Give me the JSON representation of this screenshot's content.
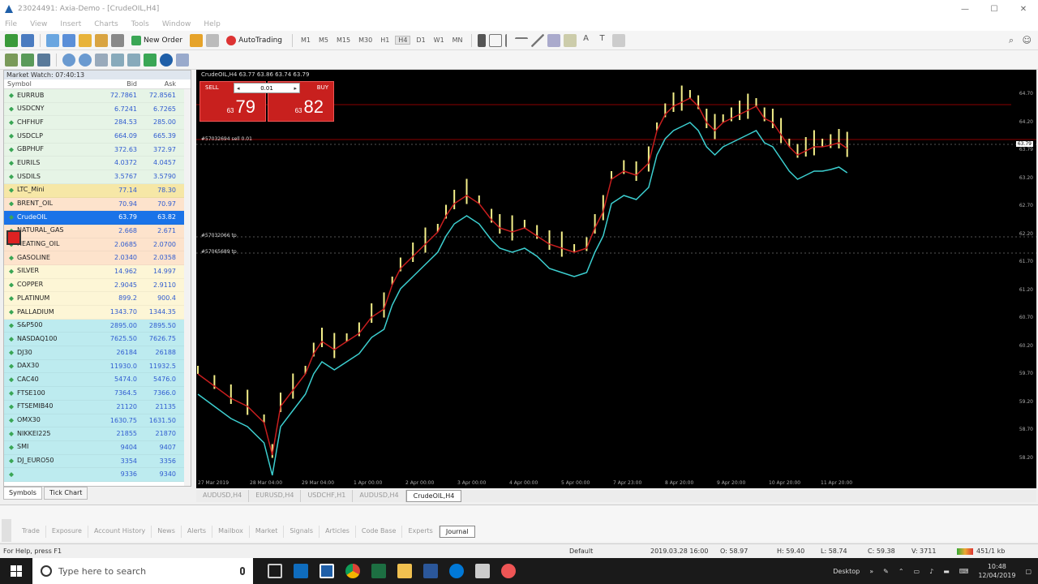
{
  "window": {
    "title": "23024491: Axia-Demo - [CrudeOIL,H4]"
  },
  "menu": [
    "File",
    "View",
    "Insert",
    "Charts",
    "Tools",
    "Window",
    "Help"
  ],
  "toolbar": {
    "new_order": "New Order",
    "autotrading": "AutoTrading",
    "timeframes": [
      "M1",
      "M5",
      "M15",
      "M30",
      "H1",
      "H4",
      "D1",
      "W1",
      "MN"
    ],
    "active_timeframe": "H4"
  },
  "market_watch": {
    "title": "Market Watch: 07:40:13",
    "columns": [
      "Symbol",
      "Bid",
      "Ask"
    ],
    "rows": [
      {
        "symbol": "EURRUB",
        "bid": "72.7861",
        "ask": "72.8561",
        "bg": "#e6f4e6"
      },
      {
        "symbol": "USDCNY",
        "bid": "6.7241",
        "ask": "6.7265",
        "bg": "#e6f4e6"
      },
      {
        "symbol": "CHFHUF",
        "bid": "284.53",
        "ask": "285.00",
        "bg": "#e6f4e6"
      },
      {
        "symbol": "USDCLP",
        "bid": "664.09",
        "ask": "665.39",
        "bg": "#e6f4e6"
      },
      {
        "symbol": "GBPHUF",
        "bid": "372.63",
        "ask": "372.97",
        "bg": "#e6f4e6"
      },
      {
        "symbol": "EURILS",
        "bid": "4.0372",
        "ask": "4.0457",
        "bg": "#e6f4e6"
      },
      {
        "symbol": "USDILS",
        "bid": "3.5767",
        "ask": "3.5790",
        "bg": "#e6f4e6"
      },
      {
        "symbol": "LTC_Mini",
        "bid": "77.14",
        "ask": "78.30",
        "bg": "#f6e7a6"
      },
      {
        "symbol": "BRENT_OIL",
        "bid": "70.94",
        "ask": "70.97",
        "bg": "#fde3cc"
      },
      {
        "symbol": "CrudeOIL",
        "bid": "63.79",
        "ask": "63.82",
        "bg": "#1a73e8",
        "selected": true
      },
      {
        "symbol": "NATURAL_GAS",
        "bid": "2.668",
        "ask": "2.671",
        "bg": "#fde3cc"
      },
      {
        "symbol": "HEATING_OIL",
        "bid": "2.0685",
        "ask": "2.0700",
        "bg": "#fde3cc"
      },
      {
        "symbol": "GASOLINE",
        "bid": "2.0340",
        "ask": "2.0358",
        "bg": "#fde3cc"
      },
      {
        "symbol": "SILVER",
        "bid": "14.962",
        "ask": "14.997",
        "bg": "#fdf6d6"
      },
      {
        "symbol": "COPPER",
        "bid": "2.9045",
        "ask": "2.9110",
        "bg": "#fdf6d6"
      },
      {
        "symbol": "PLATINUM",
        "bid": "899.2",
        "ask": "900.4",
        "bg": "#fdf6d6"
      },
      {
        "symbol": "PALLADIUM",
        "bid": "1343.70",
        "ask": "1344.35",
        "bg": "#fdf6d6"
      },
      {
        "symbol": "S&P500",
        "bid": "2895.00",
        "ask": "2895.50",
        "bg": "#bdebef"
      },
      {
        "symbol": "NASDAQ100",
        "bid": "7625.50",
        "ask": "7626.75",
        "bg": "#bdebef"
      },
      {
        "symbol": "DJ30",
        "bid": "26184",
        "ask": "26188",
        "bg": "#bdebef"
      },
      {
        "symbol": "DAX30",
        "bid": "11930.0",
        "ask": "11932.5",
        "bg": "#bdebef"
      },
      {
        "symbol": "CAC40",
        "bid": "5474.0",
        "ask": "5476.0",
        "bg": "#bdebef"
      },
      {
        "symbol": "FTSE100",
        "bid": "7364.5",
        "ask": "7366.0",
        "bg": "#bdebef"
      },
      {
        "symbol": "FTSEMIB40",
        "bid": "21120",
        "ask": "21135",
        "bg": "#bdebef"
      },
      {
        "symbol": "OMX30",
        "bid": "1630.75",
        "ask": "1631.50",
        "bg": "#bdebef"
      },
      {
        "symbol": "NIKKEI225",
        "bid": "21855",
        "ask": "21870",
        "bg": "#bdebef"
      },
      {
        "symbol": "SMI",
        "bid": "9404",
        "ask": "9407",
        "bg": "#bdebef"
      },
      {
        "symbol": "DJ_EURO50",
        "bid": "3354",
        "ask": "3356",
        "bg": "#bdebef"
      },
      {
        "symbol": "",
        "bid": "9336",
        "ask": "9340",
        "bg": "#bdebef"
      }
    ],
    "tabs": [
      "Symbols",
      "Tick Chart"
    ]
  },
  "chart": {
    "title": "CrudeOIL,H4  63.77 63.86 63.74 63.79",
    "sell_label": "SELL",
    "buy_label": "BUY",
    "lot": "0.01",
    "sell_price_small": "63",
    "sell_price_big": "79",
    "buy_price_small": "63",
    "buy_price_big": "82",
    "trade_labels": [
      "#57032694 sell 0.01",
      "#57032066 tp",
      "#57065689 tp"
    ],
    "y_ticks": [
      "64.70",
      "64.20",
      "63.79",
      "63.20",
      "62.70",
      "62.20",
      "61.70",
      "61.20",
      "60.70",
      "60.20",
      "59.70",
      "59.20",
      "58.70",
      "58.20"
    ],
    "current_price_tag": "63.79",
    "x_ticks": [
      "27 Mar 2019",
      "28 Mar 04:00",
      "29 Mar 04:00",
      "1 Apr 00:00",
      "2 Apr 00:00",
      "3 Apr 00:00",
      "4 Apr 00:00",
      "5 Apr 00:00",
      "7 Apr 23:00",
      "8 Apr 20:00",
      "9 Apr 20:00",
      "10 Apr 20:00",
      "11 Apr 20:00"
    ],
    "colors": {
      "candle": "#f5f08a",
      "ma_fast": "#c81e1e",
      "ma_slow": "#3ccfd0",
      "trade_line": "#8b0000"
    }
  },
  "chart_tabs": [
    "AUDUSD,H4",
    "EURUSD,H4",
    "USDCHF,H1",
    "AUDUSD,H4",
    "CrudeOIL,H4"
  ],
  "toolbox_tabs": [
    "Trade",
    "Exposure",
    "Account History",
    "News",
    "Alerts",
    "Mailbox",
    "Market",
    "Signals",
    "Articles",
    "Code Base",
    "Experts",
    "Journal"
  ],
  "statusbar": {
    "help": "For Help, press F1",
    "profile": "Default",
    "datetime": "2019.03.28 16:00",
    "open": "O: 58.97",
    "high": "H: 59.40",
    "low": "L: 58.74",
    "close": "C: 59.38",
    "volume": "V: 3711",
    "traffic": "451/1 kb"
  },
  "taskbar": {
    "search_placeholder": "Type here to search",
    "desktop": "Desktop",
    "time": "10:48",
    "date": "12/04/2019"
  }
}
